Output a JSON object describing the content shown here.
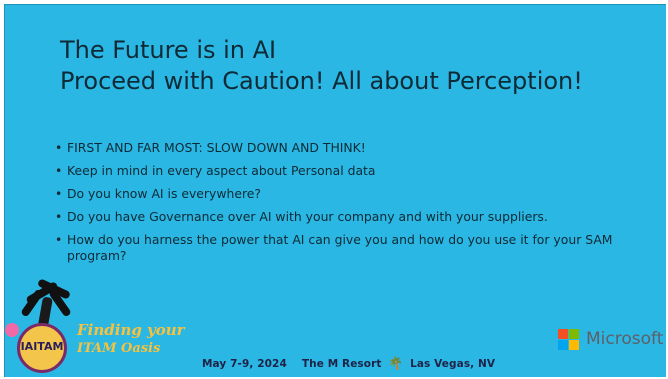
{
  "slide": {
    "title_line1": "The Future is in AI",
    "title_line2": "Proceed with Caution! All about Perception!",
    "bullet_symbol": "•",
    "bullets": [
      "FIRST AND FAR MOST:  SLOW DOWN AND THINK!",
      "Keep in mind in every aspect about Personal data",
      "Do you know AI is everywhere?",
      "Do you have Governance over AI with your company and with your suppliers.",
      "How do you harness the power that AI can give you and how do you use it for your SAM program?"
    ]
  },
  "footer": {
    "logo_badge": "IAITAM",
    "logo_line1": "Finding your",
    "logo_line2": "ITAM Oasis",
    "event_dates": "May 7-9, 2024",
    "event_venue": "The M Resort",
    "event_location": "Las Vegas, NV",
    "sponsor": "Microsoft"
  },
  "colors": {
    "background": "#2ab7e3",
    "text": "#0e2a36",
    "logo_gold": "#f7c23d",
    "ms_red": "#f25022",
    "ms_green": "#7fba00",
    "ms_blue": "#00a4ef",
    "ms_yellow": "#ffb900"
  },
  "icons": {
    "palm": "palm-tree-icon",
    "microsoft": "microsoft-logo-icon"
  }
}
